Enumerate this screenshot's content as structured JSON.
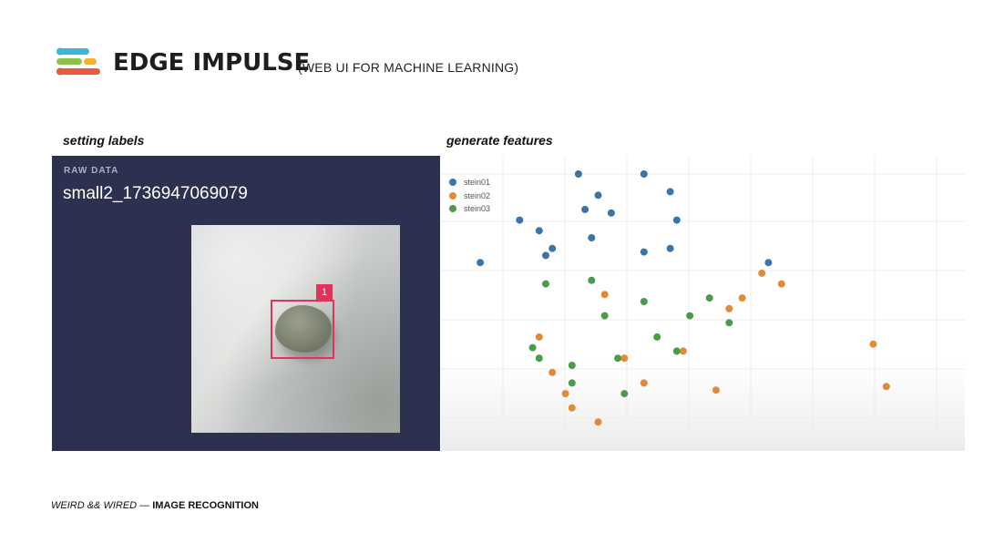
{
  "header": {
    "title": "EDGE IMPULSE",
    "subtitle": "(WEB UI  FOR MACHINE LEARNING)",
    "logo_icon": "edge-impulse-logo"
  },
  "labels": {
    "left": "setting labels",
    "right": "generate features"
  },
  "raw_data": {
    "header": "RAW DATA",
    "filename": "small2_1736947069079",
    "box_label": "1",
    "box_color": "#e0335b",
    "panel_color": "#2c3150"
  },
  "chart_data": {
    "type": "scatter",
    "legend_placement": "top-left",
    "grid": true,
    "series": [
      {
        "name": "stein01",
        "color": "#3a74a8",
        "points": [
          [
            2.2,
            1.0
          ],
          [
            2.1,
            0.0
          ],
          [
            0.6,
            2.5
          ],
          [
            1.7,
            2.1
          ],
          [
            3.5,
            2.1
          ],
          [
            5.0,
            2.5
          ],
          [
            3.1,
            2.2
          ],
          [
            2.6,
            1.1
          ],
          [
            2.4,
            0.6
          ],
          [
            1.2,
            1.3
          ],
          [
            3.1,
            0.0
          ],
          [
            3.5,
            0.5
          ],
          [
            3.6,
            1.3
          ],
          [
            1.6,
            2.3
          ],
          [
            1.5,
            1.6
          ],
          [
            2.3,
            1.8
          ]
        ]
      },
      {
        "name": "stein02",
        "color": "#e08a3a",
        "points": [
          [
            4.9,
            2.8
          ],
          [
            5.2,
            3.1
          ],
          [
            2.5,
            3.4
          ],
          [
            4.6,
            3.5
          ],
          [
            4.4,
            3.8
          ],
          [
            1.5,
            4.6
          ],
          [
            1.7,
            5.6
          ],
          [
            2.8,
            5.2
          ],
          [
            6.6,
            4.8
          ],
          [
            3.7,
            5.0
          ],
          [
            3.1,
            5.9
          ],
          [
            4.2,
            6.1
          ],
          [
            6.8,
            6.0
          ],
          [
            1.9,
            6.2
          ],
          [
            2.0,
            6.6
          ],
          [
            2.4,
            7.0
          ]
        ]
      },
      {
        "name": "stein03",
        "color": "#4c9a4c",
        "points": [
          [
            2.3,
            3.0
          ],
          [
            1.6,
            3.1
          ],
          [
            2.5,
            4.0
          ],
          [
            3.8,
            4.0
          ],
          [
            4.1,
            3.5
          ],
          [
            1.4,
            4.9
          ],
          [
            1.5,
            5.2
          ],
          [
            2.7,
            5.2
          ],
          [
            3.6,
            5.0
          ],
          [
            4.4,
            4.2
          ],
          [
            3.3,
            4.6
          ],
          [
            3.1,
            3.6
          ],
          [
            2.0,
            5.4
          ],
          [
            2.0,
            5.9
          ],
          [
            2.8,
            6.2
          ]
        ]
      }
    ]
  },
  "footer": {
    "brand": "WEIRD && WIRED",
    "separator": " — ",
    "section": "IMAGE RECOGNITION"
  }
}
